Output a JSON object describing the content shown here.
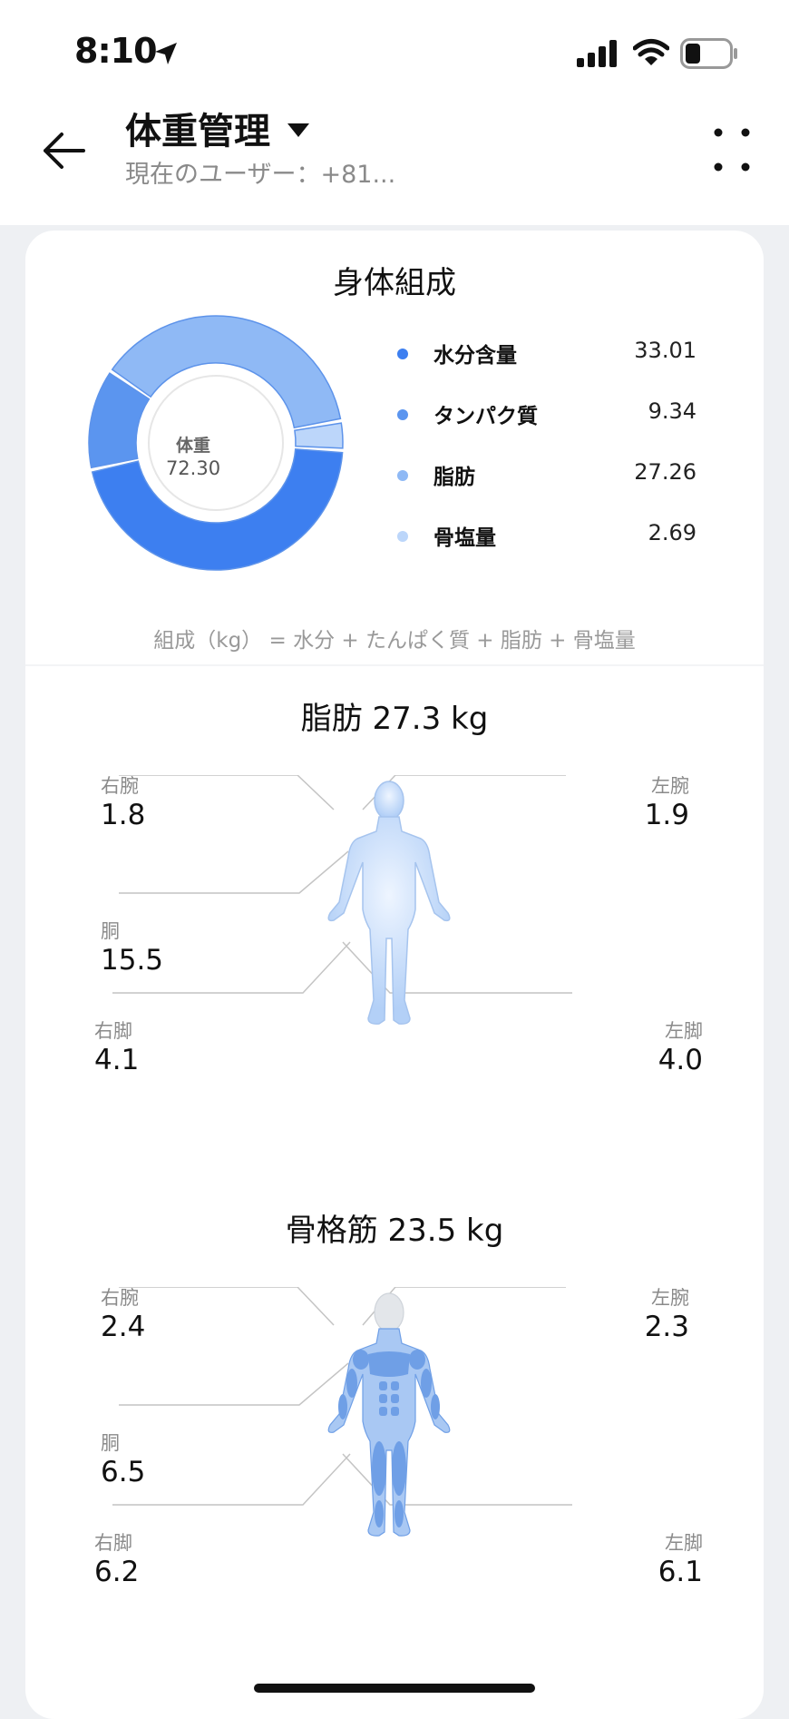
{
  "status": {
    "time": "8:10"
  },
  "header": {
    "title": "体重管理",
    "subtitle": "現在のユーザー：+81..."
  },
  "composition": {
    "title": "身体組成",
    "center_label": "体重",
    "center_value": "72.30",
    "legend": [
      {
        "label": "水分含量",
        "value": "33.01",
        "color": "#3d7ff0"
      },
      {
        "label": "タンパク質",
        "value": "9.34",
        "color": "#5b95ef"
      },
      {
        "label": "脂肪",
        "value": "27.26",
        "color": "#8fb9f5"
      },
      {
        "label": "骨塩量",
        "value": "2.69",
        "color": "#bcd6fa"
      }
    ],
    "formula": "組成（kg） = 水分 + たんぱく質 + 脂肪 + 骨塩量"
  },
  "fat": {
    "title": "脂肪 27.3 kg",
    "right_arm": {
      "label": "右腕",
      "value": "1.8"
    },
    "left_arm": {
      "label": "左腕",
      "value": "1.9"
    },
    "trunk": {
      "label": "胴",
      "value": "15.5"
    },
    "right_leg": {
      "label": "右脚",
      "value": "4.1"
    },
    "left_leg": {
      "label": "左脚",
      "value": "4.0"
    }
  },
  "muscle": {
    "title": "骨格筋 23.5 kg",
    "right_arm": {
      "label": "右腕",
      "value": "2.4"
    },
    "left_arm": {
      "label": "左腕",
      "value": "2.3"
    },
    "trunk": {
      "label": "胴",
      "value": "6.5"
    },
    "right_leg": {
      "label": "右脚",
      "value": "6.2"
    },
    "left_leg": {
      "label": "左脚",
      "value": "6.1"
    }
  },
  "icons": [
    "location-arrow-icon",
    "signal-icon",
    "wifi-icon",
    "battery-icon",
    "back-arrow-icon",
    "caret-down-icon",
    "more-icon"
  ]
}
